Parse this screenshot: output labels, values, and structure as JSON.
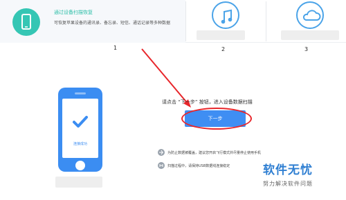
{
  "recovery_mode": {
    "title": "通过设备扫描恢复",
    "description": "可恢复苹果设备的通讯录、备忘录、短信、通话记录等多种数据",
    "icon": "phone-icon"
  },
  "other_modes": [
    {
      "icon": "music-note-icon"
    },
    {
      "icon": "cloud-icon"
    }
  ],
  "steps": [
    "1",
    "2",
    "3"
  ],
  "device": {
    "status": "连接成功",
    "check_icon": "checkmark-icon"
  },
  "main": {
    "instruction": "请点击 “下一步” 按钮，进入设备数据扫描",
    "next_button": "下一步"
  },
  "tips": [
    "为防止数据被覆盖，建议您开启飞行模式并尽量停止使用手机",
    "扫描过程中，请保持USB数据线连接稳定"
  ],
  "watermark": {
    "title": "软件无忧",
    "subtitle": "努力解决软件问题"
  },
  "colors": {
    "accent_teal": "#35c6b4",
    "primary_blue": "#3f8ef3",
    "annotation_red": "#e8262b"
  }
}
